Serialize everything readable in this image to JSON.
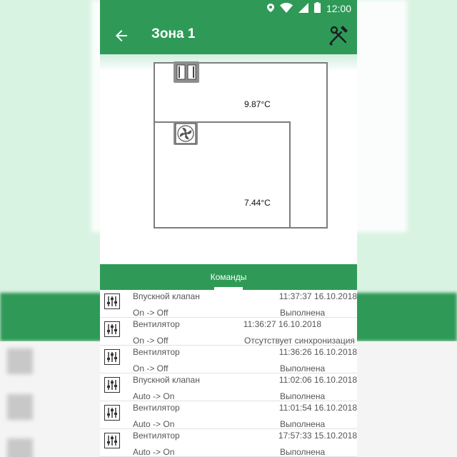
{
  "status_bar": {
    "time": "12:00"
  },
  "app_bar": {
    "title": "Зона 1"
  },
  "plan": {
    "rooms": [
      {
        "temperature": "9.87°C",
        "device_icon": "valve-icon"
      },
      {
        "temperature": "7.44°C",
        "device_icon": "fan-icon"
      }
    ]
  },
  "tabs": {
    "commands_label": "Команды"
  },
  "commands": [
    {
      "device": "Впускной клапан",
      "change": "On -> Off",
      "time": "11:37:37 16.10.2018",
      "status": "Выполнена"
    },
    {
      "device": "Вентилятор",
      "change": "On -> Off",
      "time": "11:36:27 16.10.2018",
      "status": "Отсутствует синхронизация"
    },
    {
      "device": "Вентилятор",
      "change": "On -> Off",
      "time": "11:36:26 16.10.2018",
      "status": "Выполнена"
    },
    {
      "device": "Впускной клапан",
      "change": "Auto -> On",
      "time": "11:02:06 16.10.2018",
      "status": "Выполнена"
    },
    {
      "device": "Вентилятор",
      "change": "Auto -> On",
      "time": "11:01:54 16.10.2018",
      "status": "Выполнена"
    },
    {
      "device": "Вентилятор",
      "change": "Auto -> On",
      "time": "17:57:33 15.10.2018",
      "status": "Выполнена"
    }
  ],
  "colors": {
    "primary": "#2f9a58",
    "text": "#555555",
    "wall": "#7d7d7d"
  }
}
